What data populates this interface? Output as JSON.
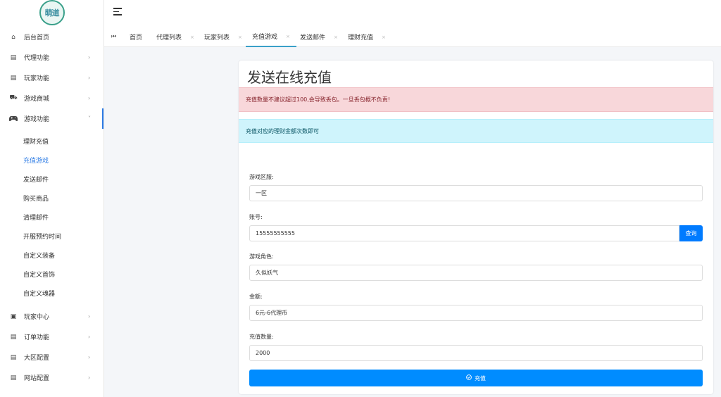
{
  "sidebar": {
    "logo_text": "萌道",
    "items": [
      {
        "label": "后台首页",
        "icon": "home-icon",
        "glyph": "⌂",
        "arrow": ""
      },
      {
        "label": "代理功能",
        "icon": "list-icon",
        "glyph": "▤",
        "arrow": "›"
      },
      {
        "label": "玩家功能",
        "icon": "list-icon",
        "glyph": "▤",
        "arrow": "›"
      },
      {
        "label": "游戏商城",
        "icon": "cart-icon",
        "glyph": "⛟",
        "arrow": "›"
      },
      {
        "label": "游戏功能",
        "icon": "gamepad-icon",
        "glyph": "🎮",
        "arrow": "˅"
      }
    ],
    "sub_items": [
      "理财充值",
      "充值游戏",
      "发送邮件",
      "购买商品",
      "清理邮件",
      "开服预约时间",
      "自定义装备",
      "自定义首饰",
      "自定义魂器"
    ],
    "active_sub": 1,
    "bottom_items": [
      {
        "label": "玩家中心",
        "icon": "user-card-icon",
        "glyph": "▣",
        "arrow": "›"
      },
      {
        "label": "订单功能",
        "icon": "list-icon",
        "glyph": "▤",
        "arrow": "›"
      },
      {
        "label": "大区配置",
        "icon": "list-icon",
        "glyph": "▤",
        "arrow": "›"
      },
      {
        "label": "网站配置",
        "icon": "list-icon",
        "glyph": "▤",
        "arrow": "›"
      }
    ]
  },
  "tabs": {
    "first_glyph": "⏮",
    "items": [
      {
        "label": "首页",
        "close": ""
      },
      {
        "label": "代理列表",
        "close": "×"
      },
      {
        "label": "玩家列表",
        "close": "×"
      },
      {
        "label": "充值游戏",
        "close": "×"
      },
      {
        "label": "发送邮件",
        "close": "×"
      },
      {
        "label": "理财充值",
        "close": "×"
      }
    ],
    "active": 3
  },
  "card": {
    "title": "发送在线充值",
    "alert_danger": "充值数量不建议超过100,会导致丢包。一旦丢包概不负责!",
    "alert_info": "充值对应的理财金额次数即可",
    "fields": {
      "server": {
        "label": "游戏区服:",
        "value": "一区"
      },
      "account": {
        "label": "账号:",
        "value": "15555555555"
      },
      "role": {
        "label": "游戏角色:",
        "value": "久似妖气"
      },
      "amount": {
        "label": "金额:",
        "value": "6元-6代理币"
      },
      "quantity": {
        "label": "充值数量:",
        "value": "2000"
      }
    },
    "query_button": "查询",
    "submit_button": "充值",
    "submit_icon": "check-circle-icon"
  },
  "colors": {
    "primary": "#007bff",
    "submit": "#008cff",
    "active_link": "#2c7be5",
    "danger_bg": "#f8d7da",
    "info_bg": "#cff4fc"
  }
}
